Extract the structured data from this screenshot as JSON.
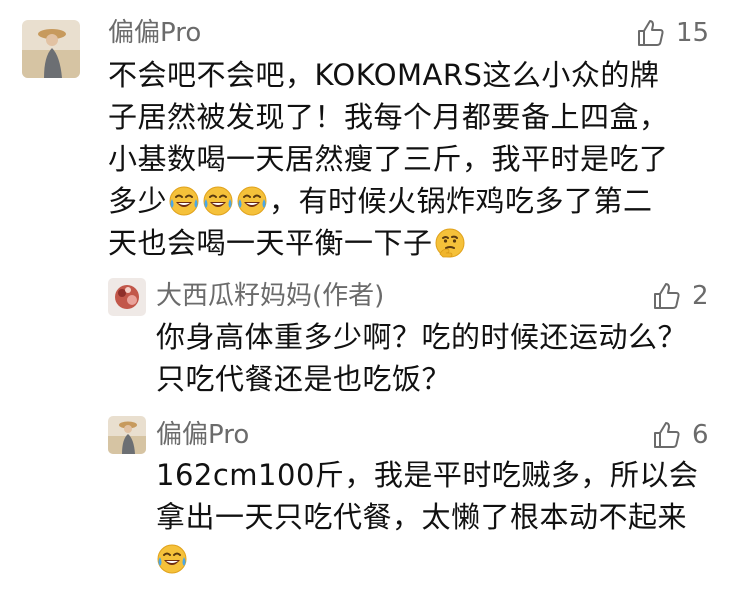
{
  "comments": [
    {
      "author": "偏偏Pro",
      "likes": "15",
      "line1": "不会吧不会吧，KOKOMARS这么小众的牌",
      "line2": "子居然被发现了！我每个月都要备上四盒，",
      "line3": "小基数喝一天居然瘦了三斤，我平时是吃了",
      "line4_start": "多少",
      "line4_end": "，有时候火锅炸鸡吃多了第二",
      "line5": "天也会喝一天平衡一下子",
      "emojis": [
        "laugh-cry-emoji",
        "laugh-cry-emoji",
        "laugh-cry-emoji",
        "thinking-emoji"
      ]
    },
    {
      "author": "大西瓜籽妈妈(作者)",
      "likes": "2",
      "line1": "你身高体重多少啊？吃的时候还运动么？",
      "line2": "只吃代餐还是也吃饭？"
    },
    {
      "author": "偏偏Pro",
      "likes": "6",
      "line1": "162cm100斤，我是平时吃贼多，所以会",
      "line2": "拿出一天只吃代餐，太懒了根本动不起来",
      "emojis": [
        "laugh-cry-emoji"
      ]
    }
  ],
  "icons": {
    "like": "thumbs-up-icon"
  },
  "colors": {
    "text": "#111111",
    "meta": "#6b6b6b",
    "emoji_face": "#f5c13a"
  }
}
